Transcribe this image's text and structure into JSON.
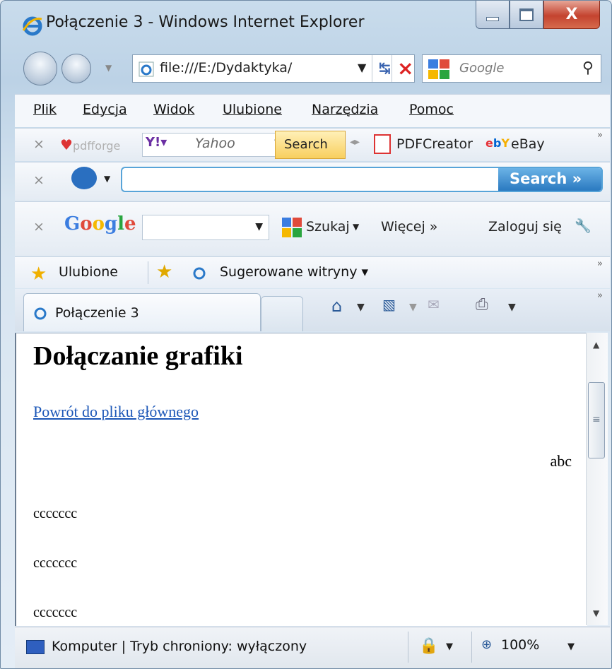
{
  "window": {
    "title": "Połączenie 3 - Windows Internet Explorer"
  },
  "window_controls": {
    "minimize": "—",
    "maximize": "☐",
    "close": "X"
  },
  "address_bar": {
    "url": "file:///E:/Dydaktyka/"
  },
  "search_box": {
    "placeholder": "Google"
  },
  "menu": {
    "items": [
      "Plik",
      "Edycja",
      "Widok",
      "Ulubione",
      "Narzędzia",
      "Pomoc"
    ]
  },
  "toolbar_pdfforge": {
    "logo": "pdfforge",
    "yahoo_placeholder": "Yahoo",
    "search_button": "Search",
    "links": [
      "PDFCreator",
      "eBay"
    ]
  },
  "toolbar_bing": {
    "search_button": "Search »"
  },
  "toolbar_google": {
    "logo": "Google",
    "search_button": "Szukaj",
    "more": "Więcej »",
    "login": "Zaloguj się"
  },
  "favorites_bar": {
    "favorites_label": "Ulubione",
    "suggested_sites": "Sugerowane witryny"
  },
  "tabs": {
    "active_tab": "Połączenie 3"
  },
  "page": {
    "heading": "Dołączanie grafiki",
    "back_link": "Powrót do pliku głównego",
    "right_text": "abc",
    "lines": [
      "ccccccc",
      "ccccccc",
      "ccccccc"
    ]
  },
  "status_bar": {
    "text": "Komputer | Tryb chroniony: wyłączony",
    "zoom": "100%"
  },
  "colors": {
    "accent_link": "#1b56b7",
    "close_button": "#c4432f",
    "bing_button": "#2a79c0",
    "search_yellow": "#f8cf5e"
  },
  "icons": [
    "ie-icon",
    "back-icon",
    "forward-icon",
    "refresh-icon",
    "stop-icon",
    "google-icon",
    "search-icon",
    "close-toolbar-icon",
    "pdf-icon",
    "ebay-icon",
    "bing-icon",
    "star-icon",
    "add-favorite-icon",
    "home-icon",
    "rss-icon",
    "mail-icon",
    "print-icon",
    "computer-icon",
    "lock-icon",
    "zoom-icon"
  ]
}
